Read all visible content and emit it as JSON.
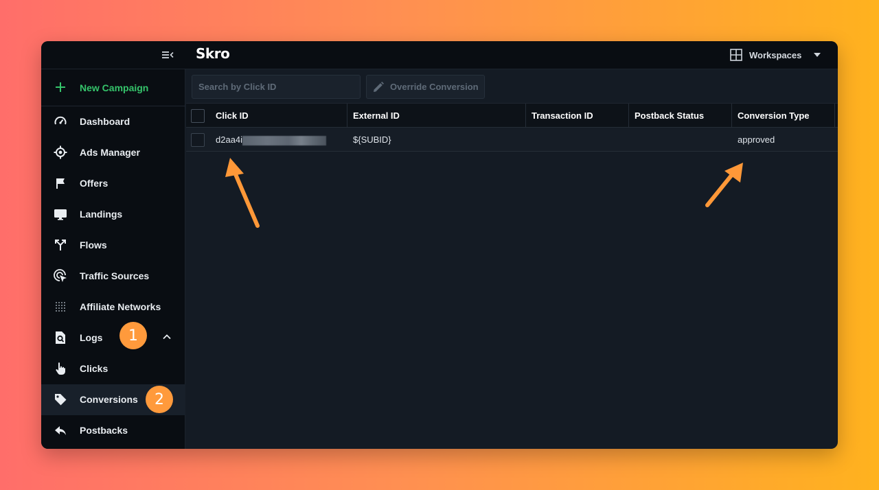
{
  "header": {
    "logo": "Skro",
    "workspaces_label": "Workspaces"
  },
  "sidebar": {
    "new_campaign": "New Campaign",
    "items": [
      {
        "label": "Dashboard",
        "icon": "gauge-icon"
      },
      {
        "label": "Ads Manager",
        "icon": "target-icon"
      },
      {
        "label": "Offers",
        "icon": "flag-icon"
      },
      {
        "label": "Landings",
        "icon": "monitor-icon"
      },
      {
        "label": "Flows",
        "icon": "split-arrows-icon"
      },
      {
        "label": "Traffic Sources",
        "icon": "cursor-click-icon"
      },
      {
        "label": "Affiliate Networks",
        "icon": "dots-grid-icon"
      },
      {
        "label": "Logs",
        "icon": "log-search-icon",
        "expanded": true
      },
      {
        "label": "Clicks",
        "icon": "hand-pointer-icon"
      },
      {
        "label": "Conversions",
        "icon": "tag-icon",
        "active": true
      },
      {
        "label": "Postbacks",
        "icon": "reply-icon"
      }
    ]
  },
  "toolbar": {
    "search_placeholder": "Search by Click ID",
    "override_label": "Override Conversion"
  },
  "table": {
    "columns": [
      "Click ID",
      "External ID",
      "Transaction ID",
      "Postback Status",
      "Conversion Type"
    ],
    "rows": [
      {
        "click_id": "d2aa4i",
        "external_id": "${SUBID}",
        "transaction_id": "",
        "postback_status": "",
        "conversion_type": "approved"
      }
    ]
  },
  "annotations": {
    "badge_1": "1",
    "badge_2": "2"
  },
  "colors": {
    "accent_green": "#35c46b",
    "badge_orange": "#ff9a3c",
    "arrow_orange": "#ff9838"
  }
}
